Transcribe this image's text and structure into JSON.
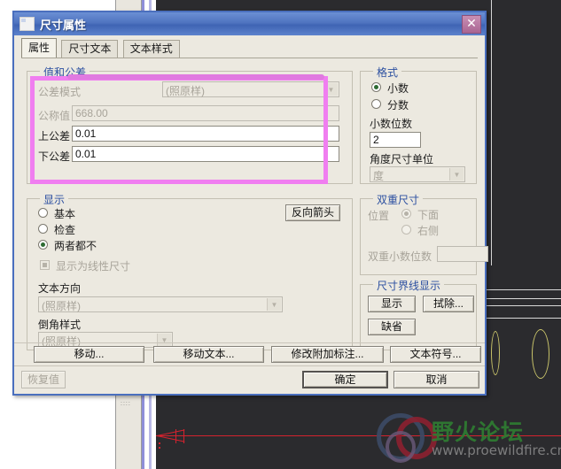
{
  "window": {
    "title": "尺寸属性",
    "icon": "window-icon",
    "close_label": "✕"
  },
  "tabs": [
    {
      "label": "属性",
      "active": true
    },
    {
      "label": "尺寸文本",
      "active": false
    },
    {
      "label": "文本样式",
      "active": false
    }
  ],
  "tolerance_group": {
    "legend": "值和公差",
    "mode_label": "公差模式",
    "mode_value": "(照原样)",
    "nominal_label": "公称值",
    "nominal_value": "668.00",
    "upper_label": "上公差",
    "upper_value": "0.01",
    "lower_label": "下公差",
    "lower_value": "0.01"
  },
  "format_group": {
    "legend": "格式",
    "decimal_label": "小数",
    "fraction_label": "分数",
    "decimal_selected": true,
    "places_label": "小数位数",
    "places_value": "2",
    "angle_unit_label": "角度尺寸单位",
    "angle_unit_value": "度"
  },
  "display_group": {
    "legend": "显示",
    "basic_label": "基本",
    "inspect_label": "检查",
    "neither_label": "两者都不",
    "selected": "两者都不",
    "linear_checkbox_label": "显示为线性尺寸",
    "flip_arrow_button": "反向箭头",
    "text_dir_label": "文本方向",
    "text_dir_value": "(照原样)",
    "chamfer_label": "倒角样式",
    "chamfer_value": "(照原样)"
  },
  "dual_group": {
    "legend": "双重尺寸",
    "position_label": "位置",
    "below_label": "下面",
    "right_label": "右侧",
    "selected": "下面",
    "dual_places_label": "双重小数位数",
    "dual_places_value": ""
  },
  "witness_group": {
    "legend": "尺寸界线显示",
    "show_button": "显示",
    "erase_button": "拭除...",
    "default_button": "缺省"
  },
  "action_buttons": [
    {
      "label": "移动..."
    },
    {
      "label": "移动文本..."
    },
    {
      "label": "修改附加标注..."
    },
    {
      "label": "文本符号..."
    }
  ],
  "footer": {
    "restore_label": "恢复值",
    "ok_label": "确定",
    "cancel_label": "取消"
  },
  "watermark": {
    "text": "野火论坛",
    "url": "www.proewildfire.cn"
  },
  "annotation": {
    "color": "#f07ef0",
    "shape": "rectangle-highlight"
  },
  "colors": {
    "titlebar": "#4f74c0",
    "dialog_bg": "#ece9e0",
    "group_legend": "#2b4fa0",
    "canvas_bg": "#2b2b2e",
    "dim_red": "#d4222e",
    "geometry_yellow": "#c9c46a"
  }
}
